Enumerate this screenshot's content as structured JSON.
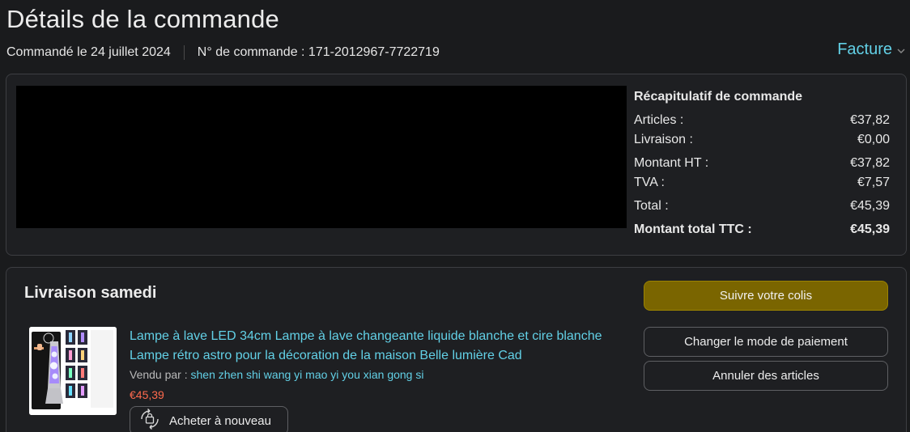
{
  "header": {
    "title": "Détails de la commande",
    "ordered_label": "Commandé le 24 juillet 2024",
    "order_number_label": "N° de commande : 171-2012967-7722719",
    "invoice_label": "Facture"
  },
  "summary": {
    "heading": "Récapitulatif de commande",
    "rows": [
      {
        "label": "Articles :",
        "value": "€37,82"
      },
      {
        "label": "Livraison :",
        "value": "€0,00"
      },
      {
        "label": "Montant HT :",
        "value": "€37,82"
      },
      {
        "label": "TVA :",
        "value": "€7,57"
      },
      {
        "label": "Total :",
        "value": "€45,39"
      },
      {
        "label": "Montant total TTC :",
        "value": "€45,39"
      }
    ]
  },
  "delivery": {
    "title": "Livraison samedi",
    "product": {
      "title": "Lampe à lave LED 34cm Lampe à lave changeante liquide blanche et cire blanche Lampe rétro astro pour la décoration de la maison Belle lumière Cad",
      "sold_by_label": "Vendu par :",
      "seller": "shen zhen shi wang yi mao yi you xian gong si",
      "price": "€45,39",
      "buy_again_label": "Acheter à nouveau"
    },
    "actions": {
      "track": "Suivre votre colis",
      "change_payment": "Changer le mode de paiement",
      "cancel_items": "Annuler des articles"
    }
  },
  "colors": {
    "background": "#1a1b1d",
    "link": "#62d0e6",
    "price": "#ff6a4d",
    "primary_button": "#7a6500"
  }
}
